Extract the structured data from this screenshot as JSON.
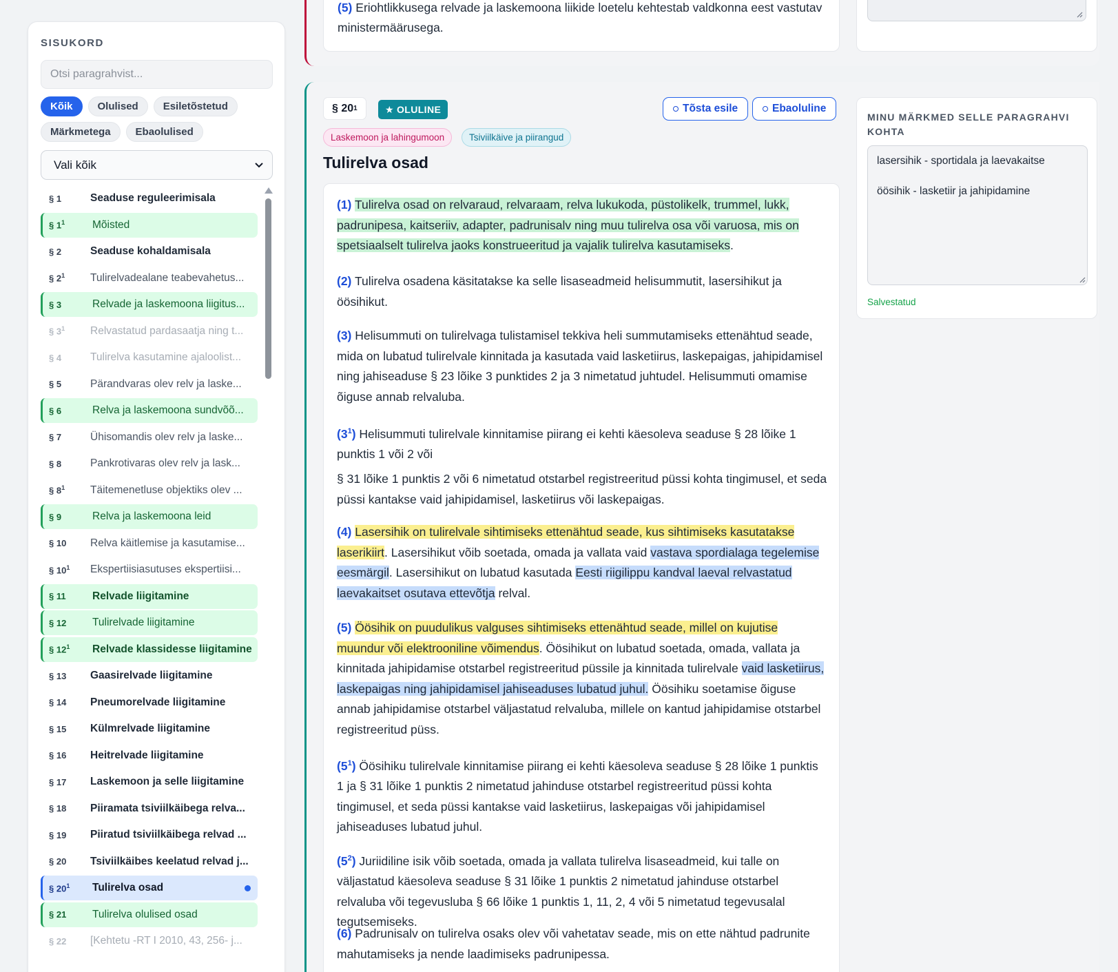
{
  "sidebar": {
    "title": "SISUKORD",
    "search_placeholder": "Otsi paragrahvist...",
    "filters": [
      "Kõik",
      "Olulised",
      "Esiletõstetud",
      "Märkmetega",
      "Ebaolulised"
    ],
    "active_filter": "Kõik",
    "select_value": "Vali kõik",
    "items": [
      {
        "num": "§ 1",
        "sup": "",
        "label": "Seaduse reguleerimisala",
        "style": "bold"
      },
      {
        "num": "§ 1",
        "sup": "1",
        "label": "Mõisted",
        "style": "green"
      },
      {
        "num": "§ 2",
        "sup": "",
        "label": "Seaduse kohaldamisala",
        "style": "bold"
      },
      {
        "num": "§ 2",
        "sup": "1",
        "label": "Tulirelvadealane teabevahetus...",
        "style": "normal"
      },
      {
        "num": "§ 3",
        "sup": "",
        "label": "Relvade ja laskemoona liigitus...",
        "style": "green"
      },
      {
        "num": "§ 3",
        "sup": "1",
        "label": "Relvastatud pardasaatja ning t...",
        "style": "dim"
      },
      {
        "num": "§ 4",
        "sup": "",
        "label": "Tulirelva kasutamine ajaloolist...",
        "style": "dim"
      },
      {
        "num": "§ 5",
        "sup": "",
        "label": "Pärandvaras olev relv ja laske...",
        "style": "normal"
      },
      {
        "num": "§ 6",
        "sup": "",
        "label": "Relva ja laskemoona sundvõõ...",
        "style": "green"
      },
      {
        "num": "§ 7",
        "sup": "",
        "label": "Ühisomandis olev relv ja laske...",
        "style": "normal"
      },
      {
        "num": "§ 8",
        "sup": "",
        "label": "Pankrotivaras olev relv ja lask...",
        "style": "normal"
      },
      {
        "num": "§ 8",
        "sup": "1",
        "label": "Täitemenetluse objektiks olev ...",
        "style": "normal"
      },
      {
        "num": "§ 9",
        "sup": "",
        "label": "Relva ja laskemoona leid",
        "style": "green"
      },
      {
        "num": "§ 10",
        "sup": "",
        "label": "Relva käitlemise ja kasutamise...",
        "style": "normal"
      },
      {
        "num": "§ 10",
        "sup": "1",
        "label": "Ekspertiisiasutuses ekspertiisi...",
        "style": "normal"
      },
      {
        "num": "§ 11",
        "sup": "",
        "label": "Relvade liigitamine",
        "style": "green bold"
      },
      {
        "num": "§ 12",
        "sup": "",
        "label": "Tulirelvade liigitamine",
        "style": "green"
      },
      {
        "num": "§ 12",
        "sup": "1",
        "label": "Relvade klassidesse liigitamine",
        "style": "green bold"
      },
      {
        "num": "§ 13",
        "sup": "",
        "label": "Gaasirelvade liigitamine",
        "style": "bold"
      },
      {
        "num": "§ 14",
        "sup": "",
        "label": "Pneumorelvade liigitamine",
        "style": "bold"
      },
      {
        "num": "§ 15",
        "sup": "",
        "label": "Külmrelvade liigitamine",
        "style": "bold"
      },
      {
        "num": "§ 16",
        "sup": "",
        "label": "Heitrelvade liigitamine",
        "style": "bold"
      },
      {
        "num": "§ 17",
        "sup": "",
        "label": "Laskemoon ja selle liigitamine",
        "style": "bold"
      },
      {
        "num": "§ 18",
        "sup": "",
        "label": "Piiramata tsiviilkäibega relva...",
        "style": "bold"
      },
      {
        "num": "§ 19",
        "sup": "",
        "label": "Piiratud tsiviilkäibega relvad ...",
        "style": "bold"
      },
      {
        "num": "§ 20",
        "sup": "",
        "label": "Tsiviilkäibes keelatud relvad j...",
        "style": "bold"
      },
      {
        "num": "§ 20",
        "sup": "1",
        "label": "Tulirelva osad",
        "style": "sel"
      },
      {
        "num": "§ 21",
        "sup": "",
        "label": "Tulirelva olulised osad",
        "style": "green"
      },
      {
        "num": "§ 22",
        "sup": "",
        "label": "[Kehtetu -RT I 2010, 43, 256- j...",
        "style": "dim"
      }
    ]
  },
  "prev_section": {
    "num": "(5)",
    "text": "Eriohtlikkusega relvade ja laskemoona liikide loetelu kehtestab valdkonna eest vastutav ministermäärusega."
  },
  "article": {
    "num": "§ 20",
    "num_sup": "1",
    "important_badge": "OLULINE",
    "highlight_button": "Tõsta esile",
    "unimportant_button": "Ebaoluline",
    "tags": [
      "Laskemoon ja lahingumoon",
      "Tsiviilkäive ja piirangud"
    ],
    "title": "Tulirelva osad",
    "paragraphs": {
      "p1": {
        "n": "(1)",
        "a": "Tulirelva osad on relvaraud, relvaraam, relva lukukoda, püstolikelk, trummel, lukk, padrunipesa, kaitseriiv, adapter, padrunisalv ning muu tulirelva osa või varuosa, mis on spetsiaalselt tulirelva jaoks konstrueeritud ja vajalik tulirelva kasutamiseks",
        "b": "."
      },
      "p2": {
        "n": "(2)",
        "a": "Tulirelva osadena käsitatakse ka selle lisaseadmeid helisummutit, lasersihikut ja öösihikut."
      },
      "p3": {
        "n": "(3)",
        "a": "Helisummuti on tulirelvaga tulistamisel tekkiva heli summutamiseks ettenähtud seade, mida on lubatud tulirelvale kinnitada ja kasutada vaid lasketiirus, laskepaigas, jahipidamisel ning jahiseaduse § 23 lõike 3 punktides 2 ja 3 nimetatud juhtudel. Helisummuti omamise õiguse annab relvaluba."
      },
      "p31": {
        "n": "(3",
        "sup": "1",
        "n2": ")",
        "a": "Helisummuti tulirelvale kinnitamise piirang ei kehti käesoleva seaduse § 28 lõike 1 punktis 1 või 2 või"
      },
      "p31b": {
        "a": "§ 31 lõike 1 punktis 2 või 6 nimetatud otstarbel registreeritud püssi kohta tingimusel, et seda püssi kantakse vaid jahipidamisel, lasketiirus või laskepaigas."
      },
      "p4": {
        "n": "(4)",
        "hl1": "Lasersihik on tulirelvale sihtimiseks ettenähtud seade, kus sihtimiseks kasutatakse laserikiirt",
        "t1": ". Lasersihikut võib soetada, omada ja vallata vaid ",
        "hl2": "vastava spordialaga tegelemise eesmärgil",
        "t2": ". Lasersihikut on lubatud kasutada ",
        "hl3": "Eesti riigilippu kandval laeval relvastatud laevakaitset osutava ettevõtja",
        "t3": " relval."
      },
      "p5": {
        "n": "(5)",
        "hl1": "Öösihik on puudulikus valguses sihtimiseks ettenähtud seade, millel on kujutise muundur või elektrooniline võimendus",
        "t1": ". Öösihikut on lubatud soetada, omada, vallata ja kinnitada jahipidamise otstarbel registreeritud püssile ja kinnitada tulirelvale ",
        "hl2": "vaid lasketiirus, laskepaigas ning jahipidamisel jahiseaduses lubatud juhul.",
        "t2": " Öösihiku soetamise õiguse annab jahipidamise otstarbel väljastatud relvaluba, millele on kantud jahipidamise otstarbel registreeritud püss."
      },
      "p51": {
        "n": "(5",
        "sup": "1",
        "n2": ")",
        "a": "Öösihiku tulirelvale kinnitamise piirang ei kehti käesoleva seaduse § 28 lõike 1 punktis 1 ja § 31 lõike 1 punktis 2 nimetatud jahinduse otstarbel registreeritud püssi kohta tingimusel, et seda püssi kantakse vaid lasketiirus, laskepaigas või jahipidamisel jahiseaduses lubatud juhul."
      },
      "p52": {
        "n": "(5",
        "sup": "2",
        "n2": ")",
        "a": "Juriidiline isik võib soetada, omada ja vallata tulirelva lisaseadmeid, kui talle on väljastatud käesoleva seaduse § 31 lõike 1 punktis 2 nimetatud jahinduse otstarbel relvaluba või tegevusluba § 66 lõike 1 punktis 1, 11, 2, 4 või 5 nimetatud tegevusalal tegutsemiseks."
      },
      "p6": {
        "n": "(6)",
        "a": "Padrunisalv on tulirelva osaks olev või vahetatav seade, mis on ette nähtud padrunite mahutamiseks ja nende laadimiseks padrunipessa."
      }
    }
  },
  "notes": {
    "title": "MINU MÄRKMED SELLE PARAGRAHVI KOHTA",
    "text": "lasersihik - sportidala ja laevakaitse\n\nöösihik - lasketiir ja jahipidamine",
    "status": "Salvestatud"
  },
  "colors": {
    "accent": "#2563eb",
    "important": "#0e8a9a",
    "highlight_green": "#c9f2d6",
    "highlight_yellow": "#fbef8f",
    "highlight_blue": "#c6dcfb"
  }
}
